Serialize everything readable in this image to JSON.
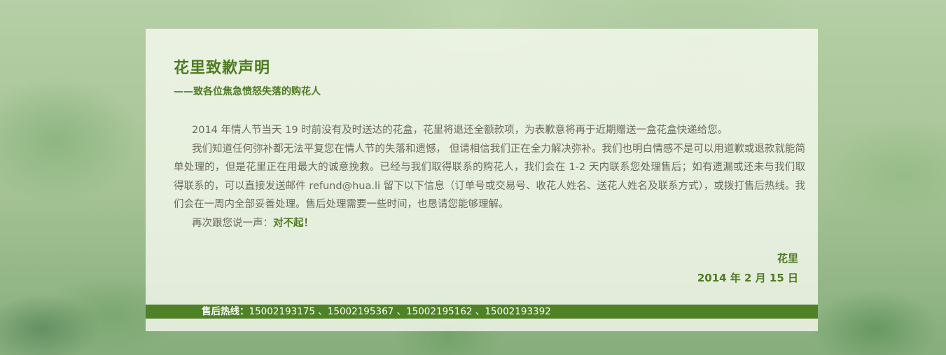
{
  "notice": {
    "title": "花里致歉声明",
    "subtitle": "——致各位焦急愤怒失落的购花人",
    "para1": "2014 年情人节当天 19 时前没有及时送达的花盒，花里将退还全额款项，为表歉意将再于近期赠送一盒花盒快递给您。",
    "para2": "我们知道任何弥补都无法平复您在情人节的失落和遗憾， 但请相信我们正在全力解决弥补。我们也明白情感不是可以用道歉或退款就能简单处理的，但是花里正在用最大的诚意挽救。已经与我们取得联系的购花人，我们会在 1-2 天内联系您处理售后；如有遗漏或还未与我们取得联系的，可以直接发送邮件 refund@hua.li 留下以下信息（订单号或交易号、收花人姓名、送花人姓名及联系方式），或拨打售后热线。我们会在一周内全部妥善处理。售后处理需要一些时间，也恳请您能够理解。",
    "para3_prefix": "再次跟您说一声：",
    "para3_emphasis": "对不起！",
    "signature_name": "花里",
    "signature_date": "2014 年 2 月 15 日"
  },
  "hotline": {
    "label": "售后热线：",
    "numbers": "15002193175 、15002195367 、15002195162 、15002193392"
  },
  "colors": {
    "brand_green": "#4f7b23",
    "bar_green": "#4f8127",
    "body_text": "#6b6b5a"
  }
}
